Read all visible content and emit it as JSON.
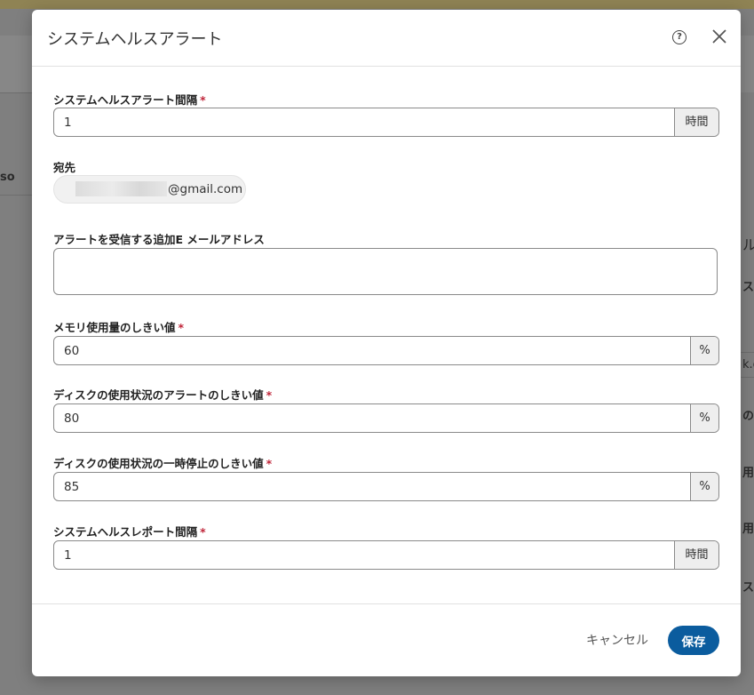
{
  "background": {
    "fragments": [
      "so",
      "ル",
      "ス",
      "k.c",
      "のし",
      "用状",
      "用状",
      "スレ"
    ]
  },
  "dialog": {
    "title": "システムヘルスアラート",
    "help_icon": "help-circle-icon",
    "close_icon": "close-icon"
  },
  "fields": {
    "alert_interval": {
      "label": "システムヘルスアラート間隔",
      "required": "*",
      "value": "1",
      "unit": "時間"
    },
    "recipient": {
      "label": "宛先",
      "email_suffix": "@gmail.com"
    },
    "additional_emails": {
      "label": "アラートを受信する追加E メールアドレス",
      "value": ""
    },
    "memory_threshold": {
      "label": "メモリ使用量のしきい値",
      "required": "*",
      "value": "60",
      "unit": "%"
    },
    "disk_alert_threshold": {
      "label": "ディスクの使用状況のアラートのしきい値",
      "required": "*",
      "value": "80",
      "unit": "%"
    },
    "disk_pause_threshold": {
      "label": "ディスクの使用状況の一時停止のしきい値",
      "required": "*",
      "value": "85",
      "unit": "%"
    },
    "report_interval": {
      "label": "システムヘルスレポート間隔",
      "required": "*",
      "value": "1",
      "unit": "時間"
    }
  },
  "footer": {
    "cancel_label": "キャンセル",
    "save_label": "保存"
  },
  "colors": {
    "primary": "#0b5c9e",
    "required": "#c0263a",
    "overlay": "#7f7f7f"
  }
}
